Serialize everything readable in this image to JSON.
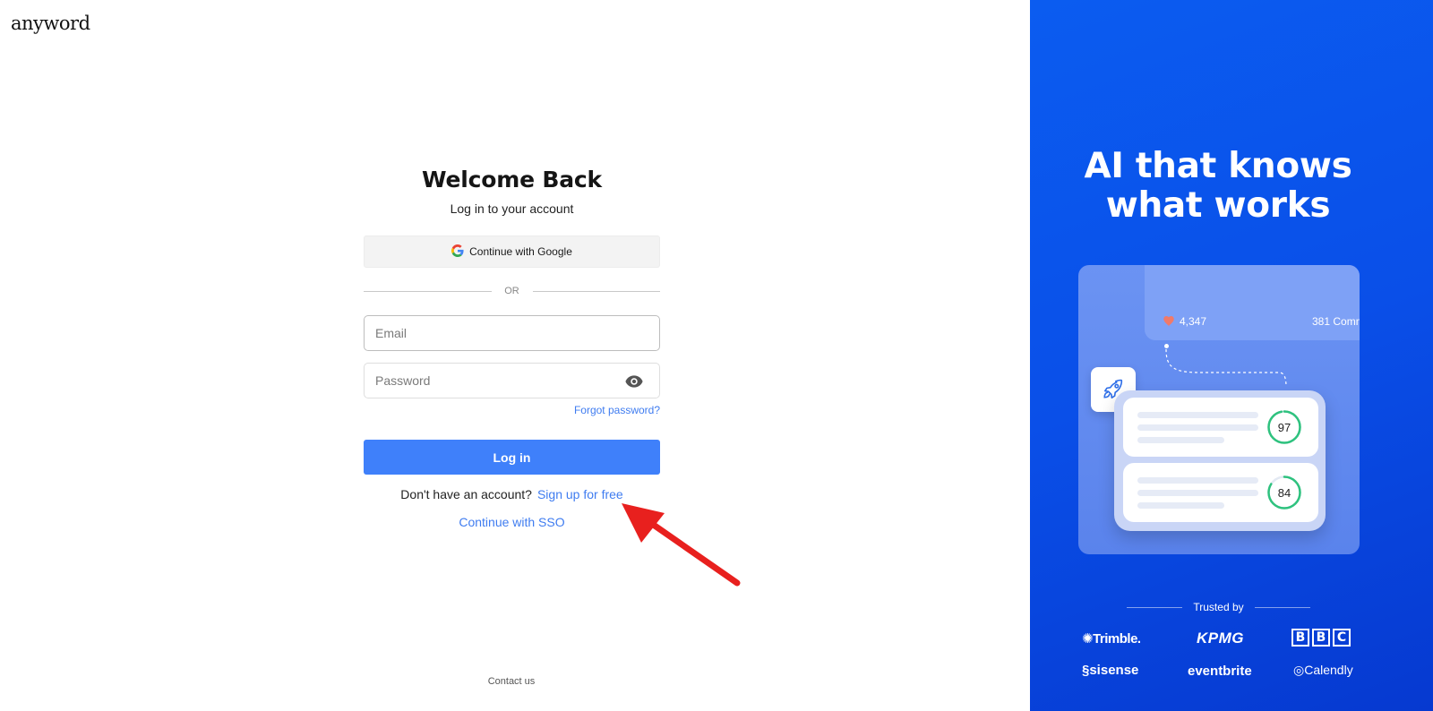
{
  "brand": {
    "logo_text": "anyword"
  },
  "login": {
    "title": "Welcome Back",
    "subtitle": "Log in to your account",
    "google_label": "Continue with Google",
    "or_label": "OR",
    "email_placeholder": "Email",
    "password_placeholder": "Password",
    "forgot_label": "Forgot password?",
    "login_label": "Log in",
    "no_account_text": "Don't have an account?",
    "signup_label": "Sign up for free",
    "sso_label": "Continue with SSO"
  },
  "footer": {
    "contact_label": "Contact us"
  },
  "annotation": {
    "arrow_color": "#e8201e",
    "arrow_icon": "red-arrow-icon"
  },
  "promo": {
    "headline_line1": "AI that knows",
    "headline_line2": "what works",
    "likes": "4,347",
    "comments": "381 Comm",
    "score_1": "97",
    "score_2": "84",
    "trusted_label": "Trusted by",
    "logos": [
      "Trimble.",
      "KPMG",
      "BBC",
      "sisense",
      "eventbrite",
      "Calendly"
    ]
  },
  "colors": {
    "accent": "#3f80fa",
    "link": "#3f7cf0",
    "panel_blue": "#0a4fe8",
    "score_green": "#2ec27e"
  }
}
